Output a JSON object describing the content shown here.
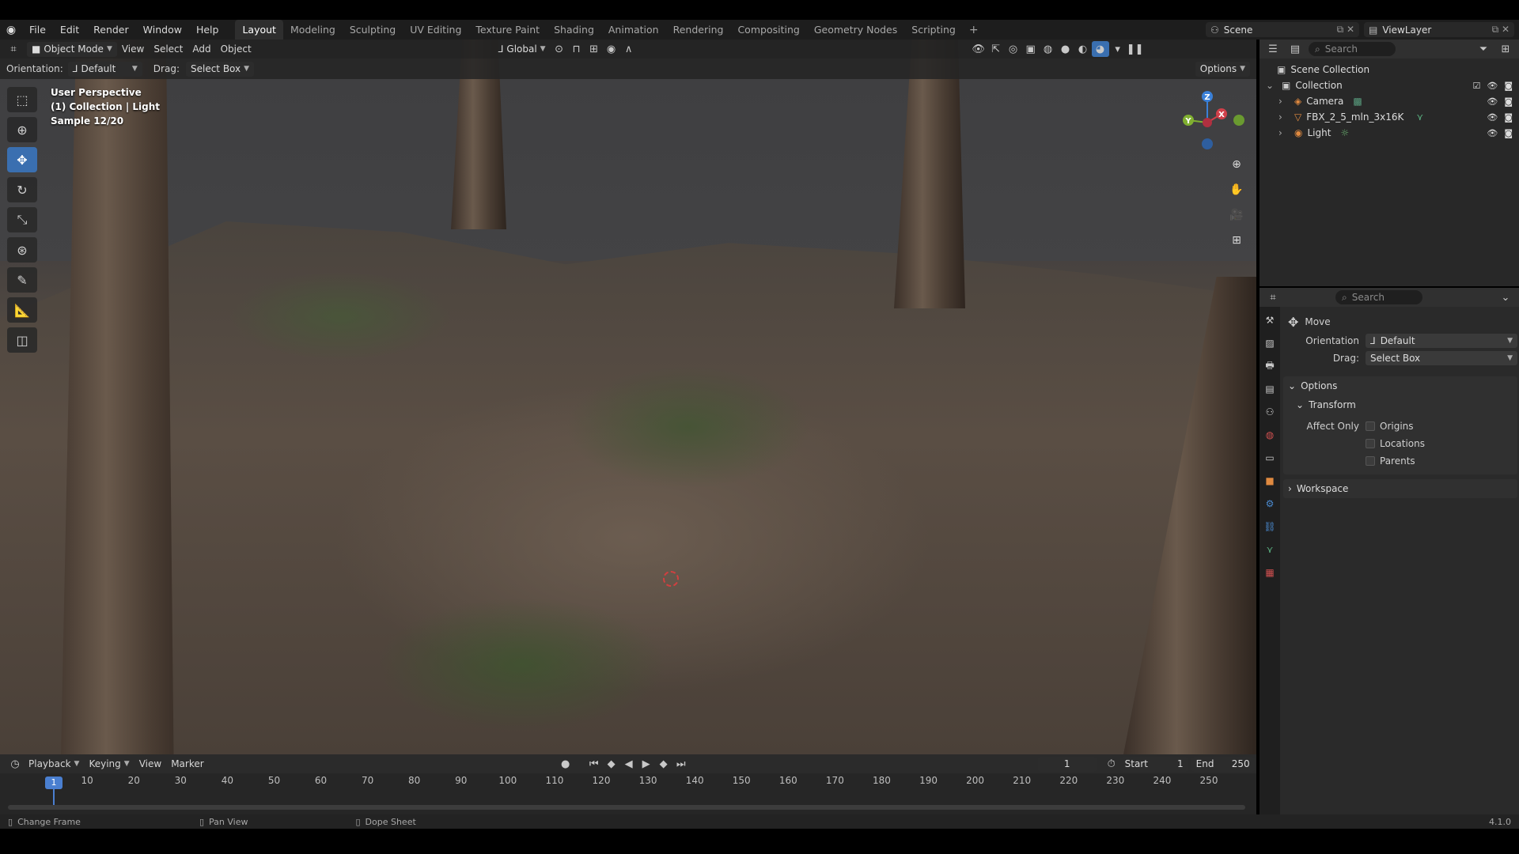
{
  "menu": {
    "items": [
      "File",
      "Edit",
      "Render",
      "Window",
      "Help"
    ],
    "workspaces": [
      "Layout",
      "Modeling",
      "Sculpting",
      "UV Editing",
      "Texture Paint",
      "Shading",
      "Animation",
      "Rendering",
      "Compositing",
      "Geometry Nodes",
      "Scripting"
    ],
    "active_workspace": "Layout",
    "scene": "Scene",
    "view_layer": "ViewLayer"
  },
  "viewport": {
    "mode": "Object Mode",
    "menus": [
      "View",
      "Select",
      "Add",
      "Object"
    ],
    "transform_orientation": "Global",
    "orientation_label": "Orientation:",
    "orientation_value": "Default",
    "drag_label": "Drag:",
    "drag_value": "Select Box",
    "options_label": "Options",
    "info_line1": "User Perspective",
    "info_line2": "(1) Collection | Light",
    "info_line3": "Sample 12/20",
    "gizmo_axes": {
      "z": "Z",
      "y": "Y",
      "x": "X"
    }
  },
  "outliner": {
    "search_placeholder": "Search",
    "root": "Scene Collection",
    "collection": "Collection",
    "items": [
      {
        "name": "Camera"
      },
      {
        "name": "FBX_2_5_mln_3x16K"
      },
      {
        "name": "Light"
      }
    ]
  },
  "properties": {
    "search_placeholder": "Search",
    "tool_name": "Move",
    "orientation_label": "Orientation",
    "orientation_value": "Default",
    "drag_label": "Drag:",
    "drag_value": "Select Box",
    "options_panel": "Options",
    "transform_panel": "Transform",
    "affect_only_label": "Affect Only",
    "affect_options": [
      "Origins",
      "Locations",
      "Parents"
    ],
    "workspace_panel": "Workspace"
  },
  "timeline": {
    "menus": [
      "Playback",
      "Keying",
      "View",
      "Marker"
    ],
    "current_frame": "1",
    "start_label": "Start",
    "start": "1",
    "end_label": "End",
    "end": "250",
    "ticks": [
      "1",
      "10",
      "20",
      "30",
      "40",
      "50",
      "60",
      "70",
      "80",
      "90",
      "100",
      "110",
      "120",
      "130",
      "140",
      "150",
      "160",
      "170",
      "180",
      "190",
      "200",
      "210",
      "220",
      "230",
      "240",
      "250"
    ]
  },
  "statusbar": {
    "hint1": "Change Frame",
    "hint2": "Pan View",
    "hint3": "Dope Sheet",
    "version": "4.1.0"
  },
  "colors": {
    "accent": "#3a6fb0",
    "axis_x": "#d0404a",
    "axis_y": "#80b030",
    "axis_z": "#3a80d8"
  }
}
